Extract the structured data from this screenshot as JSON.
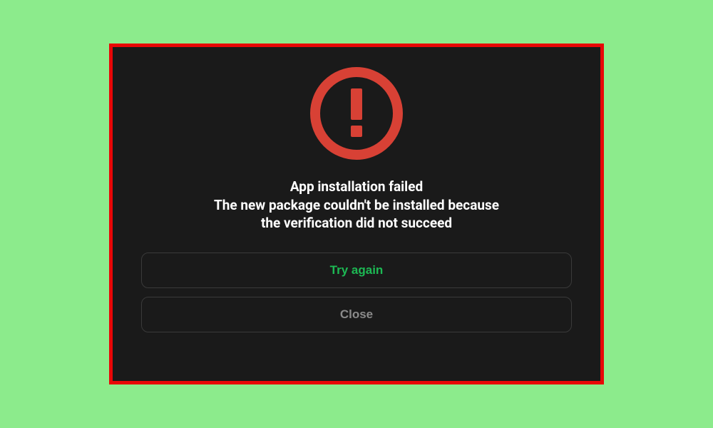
{
  "dialog": {
    "icon": "alert-exclamation-icon",
    "title": "App installation failed",
    "body_line1": "The new package couldn't be installed because",
    "body_line2": "the verification did not succeed",
    "buttons": {
      "primary": "Try again",
      "secondary": "Close"
    }
  },
  "colors": {
    "page_bg": "#8ceb8c",
    "frame_border": "#e80707",
    "dialog_bg": "#1a1a1a",
    "alert_red": "#d84135",
    "text_white": "#ffffff",
    "button_primary_text": "#1db954",
    "button_secondary_text": "#8a8a8a",
    "button_border": "#3a3a3a"
  }
}
